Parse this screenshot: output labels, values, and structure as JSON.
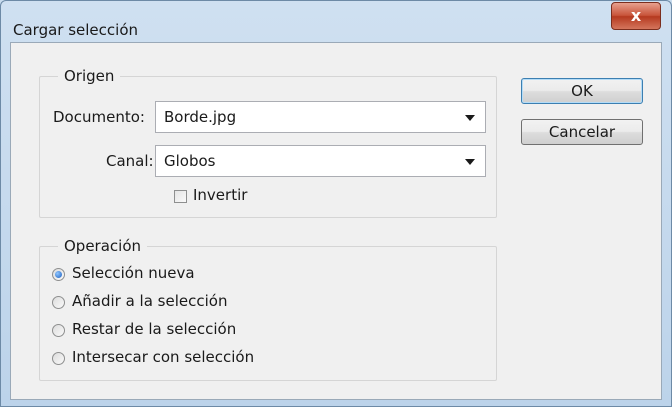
{
  "window": {
    "title": "Cargar selección",
    "close_glyph": "x"
  },
  "origen": {
    "legend": "Origen",
    "documento_label": "Documento:",
    "documento_value": "Borde.jpg",
    "canal_label": "Canal:",
    "canal_value": "Globos",
    "invertir_label": "Invertir",
    "invertir_checked": false
  },
  "operacion": {
    "legend": "Operación",
    "options": [
      {
        "label": "Selección nueva",
        "checked": true
      },
      {
        "label": "Añadir a la selección",
        "checked": false
      },
      {
        "label": "Restar de la selección",
        "checked": false
      },
      {
        "label": "Intersecar con selección",
        "checked": false
      }
    ]
  },
  "buttons": {
    "ok": "OK",
    "cancel": "Cancelar"
  }
}
